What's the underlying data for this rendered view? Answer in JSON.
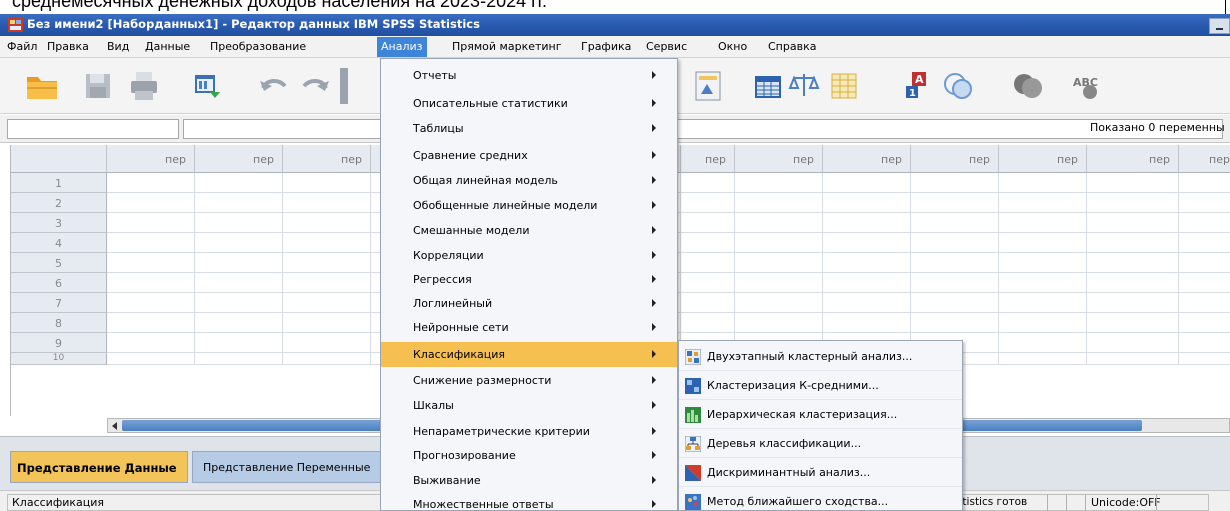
{
  "background_doc": {
    "text": "среднемесячных денежных доходов населения на 2023-2024 гг."
  },
  "window": {
    "title": "Без имени2 [Наборданных1] - Редактор данных IBM SPSS Statistics"
  },
  "menubar": {
    "items": [
      "Файл",
      "Правка",
      "Вид",
      "Данные",
      "Преобразование",
      "Анализ",
      "Прямой маркетинг",
      "Графика",
      "Сервис",
      "Окно",
      "Справка"
    ]
  },
  "toolbar": {
    "icons": [
      "open-folder-icon",
      "save-disk-icon",
      "print-icon",
      "dialog-recall-icon",
      "undo-icon",
      "redo-icon",
      "split-file-icon",
      "select-cases-icon",
      "variables-grid-icon",
      "weight-cases-icon",
      "value-labels-icon",
      "use-sets-icon",
      "circle-icon",
      "show-all-icon",
      "spell-check-icon"
    ]
  },
  "cellrow": {
    "name_value": "",
    "cell_value": "",
    "vars_shown": "Показано 0 переменны"
  },
  "grid": {
    "column_header": "пер",
    "row_numbers": [
      "1",
      "2",
      "3",
      "4",
      "5",
      "6",
      "7",
      "8",
      "9",
      "10"
    ]
  },
  "tabs": {
    "data_view": "Представление Данные",
    "variable_view": "Представление Переменные"
  },
  "statusbar": {
    "left": "Классификация",
    "processor": "atistics готов",
    "unicode": "Unicode:OFF"
  },
  "analysis_menu": {
    "items": [
      "Отчеты",
      "Описательные статистики",
      "Таблицы",
      "Сравнение средних",
      "Общая линейная модель",
      "Обобщенные линейные модели",
      "Смешанные модели",
      "Корреляции",
      "Регрессия",
      "Логлинейный",
      "Нейронные сети",
      "Классификация",
      "Снижение размерности",
      "Шкалы",
      "Непараметрические критерии",
      "Прогнозирование",
      "Выживание",
      "Множественные ответы"
    ],
    "highlighted": "Классификация"
  },
  "classification_submenu": {
    "items": [
      {
        "label": "Двухэтапный кластерный анализ...",
        "icon": "two-step-cluster-icon"
      },
      {
        "label": "Кластеризация К-средними...",
        "icon": "k-means-icon"
      },
      {
        "label": "Иерархическая кластеризация...",
        "icon": "hierarchical-cluster-icon"
      },
      {
        "label": "Деревья классификации...",
        "icon": "tree-icon"
      },
      {
        "label": "Дискриминантный анализ...",
        "icon": "discriminant-icon"
      },
      {
        "label": "Метод ближайшего сходства...",
        "icon": "nearest-neighbor-icon"
      }
    ]
  }
}
